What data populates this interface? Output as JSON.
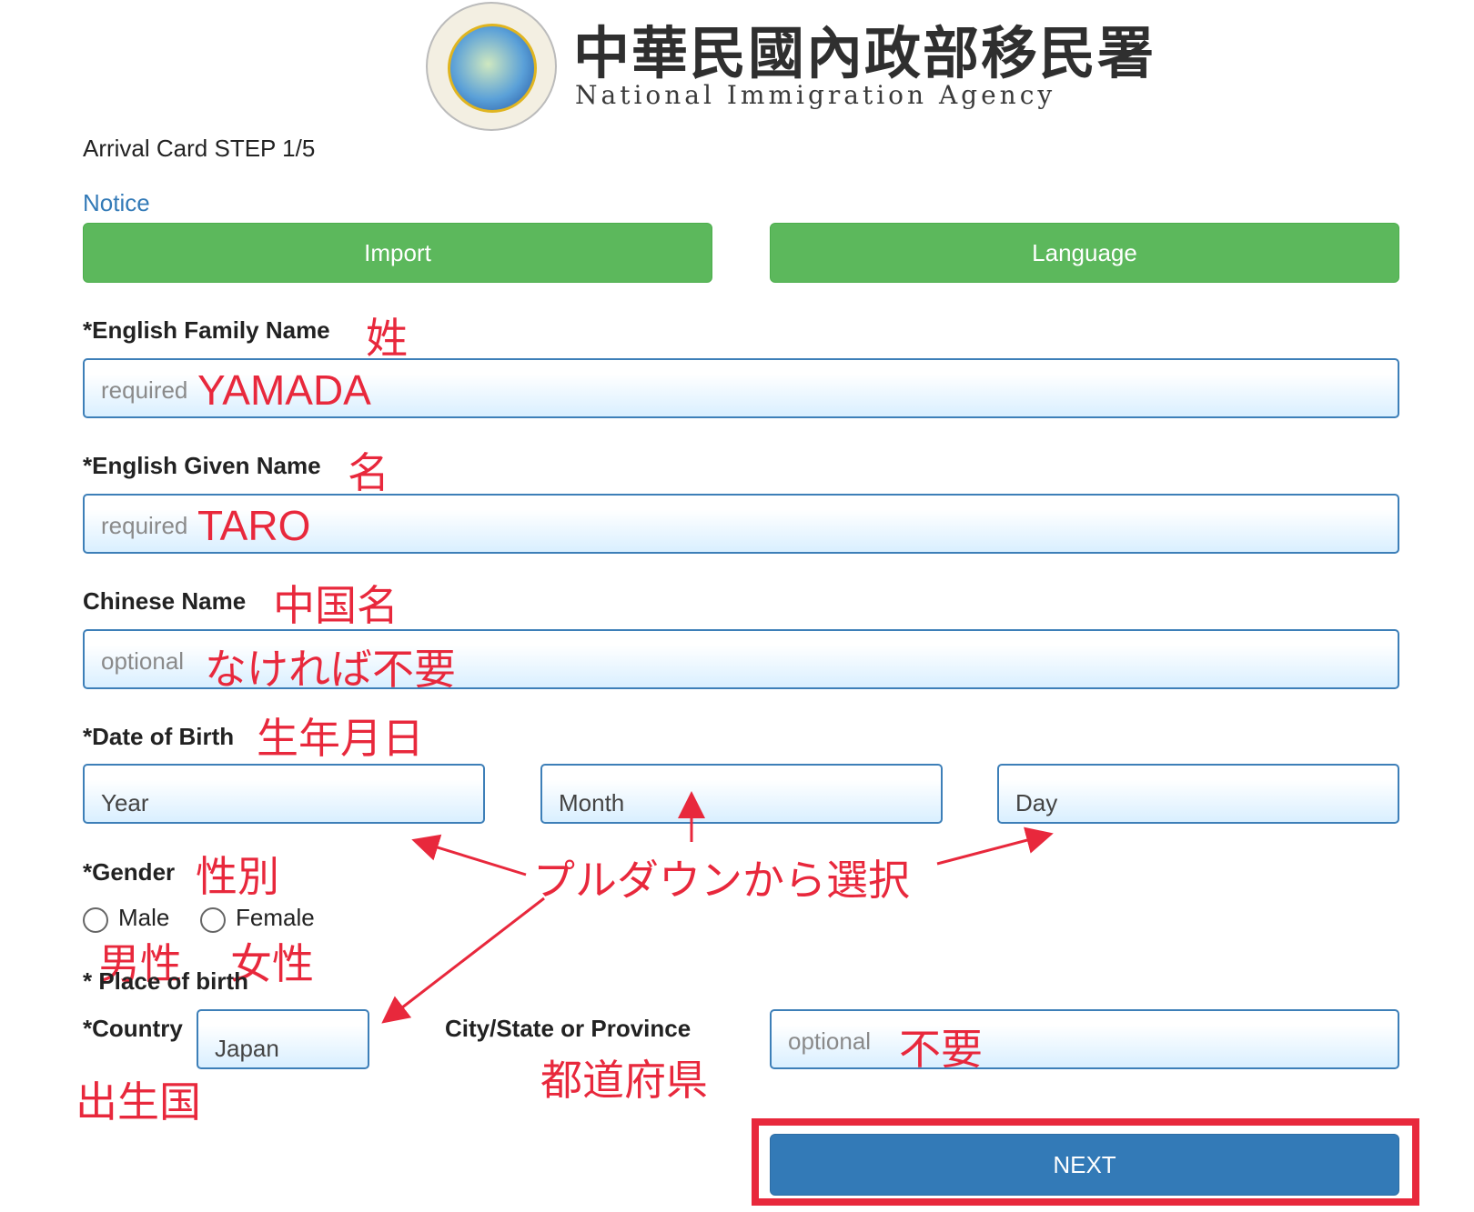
{
  "header": {
    "agency_cn": "中華民國內政部移民署",
    "agency_en": "National Immigration Agency",
    "seal_text": "內政部移民署 National Immigration Agency"
  },
  "step_title": "Arrival Card STEP 1/5",
  "notice_link": "Notice",
  "buttons": {
    "import": "Import",
    "language": "Language",
    "next": "NEXT"
  },
  "fields": {
    "family_name": {
      "label": "*English Family Name",
      "placeholder": "required",
      "annotation": "姓",
      "value": "YAMADA"
    },
    "given_name": {
      "label": "*English Given Name",
      "placeholder": "required",
      "annotation": "名",
      "value": "TARO"
    },
    "chinese_name": {
      "label": "Chinese Name",
      "placeholder": "optional",
      "annotation": "中国名",
      "value_note": "なければ不要"
    },
    "dob": {
      "label": "*Date of Birth",
      "annotation": "生年月日",
      "year": "Year",
      "month": "Month",
      "day": "Day"
    },
    "gender": {
      "label": "*Gender",
      "annotation": "性別",
      "male": "Male",
      "female": "Female",
      "male_anno": "男性",
      "female_anno": "女性"
    },
    "place_of_birth": {
      "label": "* Place of birth",
      "country_label": "*Country",
      "country_value": "Japan",
      "country_anno": "出生国",
      "city_label": "City/State or Province",
      "city_anno": "都道府県",
      "city_placeholder": "optional",
      "city_value_note": "不要"
    }
  },
  "annotations": {
    "pulldown": "プルダウンから選択"
  },
  "colors": {
    "green": "#5cb85c",
    "blue": "#337ab7",
    "annotation_red": "#e8283c",
    "input_border": "#3d7fb8"
  }
}
